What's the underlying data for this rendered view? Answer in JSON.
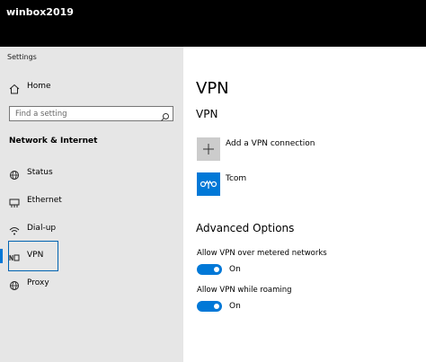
{
  "window": {
    "title": "winbox2019"
  },
  "sidebar": {
    "app_label": "Settings",
    "home": {
      "label": "Home",
      "icon": "home-icon"
    },
    "search": {
      "placeholder": "Find a setting",
      "icon": "search-icon"
    },
    "section": "Network & Internet",
    "items": [
      {
        "label": "Status",
        "icon": "globe-status-icon"
      },
      {
        "label": "Ethernet",
        "icon": "ethernet-icon"
      },
      {
        "label": "Dial-up",
        "icon": "dialup-icon"
      },
      {
        "label": "VPN",
        "icon": "vpn-icon",
        "selected": true
      },
      {
        "label": "Proxy",
        "icon": "globe-icon"
      }
    ]
  },
  "main": {
    "page_title": "VPN",
    "section_title": "VPN",
    "add_connection": {
      "label": "Add a VPN connection",
      "icon": "plus-icon"
    },
    "connections": [
      {
        "name": "Tcom",
        "icon": "vpn-connection-icon"
      }
    ],
    "advanced": {
      "title": "Advanced Options",
      "options": [
        {
          "label": "Allow VPN over metered networks",
          "state": "On",
          "enabled": true
        },
        {
          "label": "Allow VPN while roaming",
          "state": "On",
          "enabled": true
        }
      ]
    }
  },
  "colors": {
    "accent": "#0078d7",
    "sidebar_bg": "#e6e6e6",
    "topbar_bg": "#000000"
  }
}
